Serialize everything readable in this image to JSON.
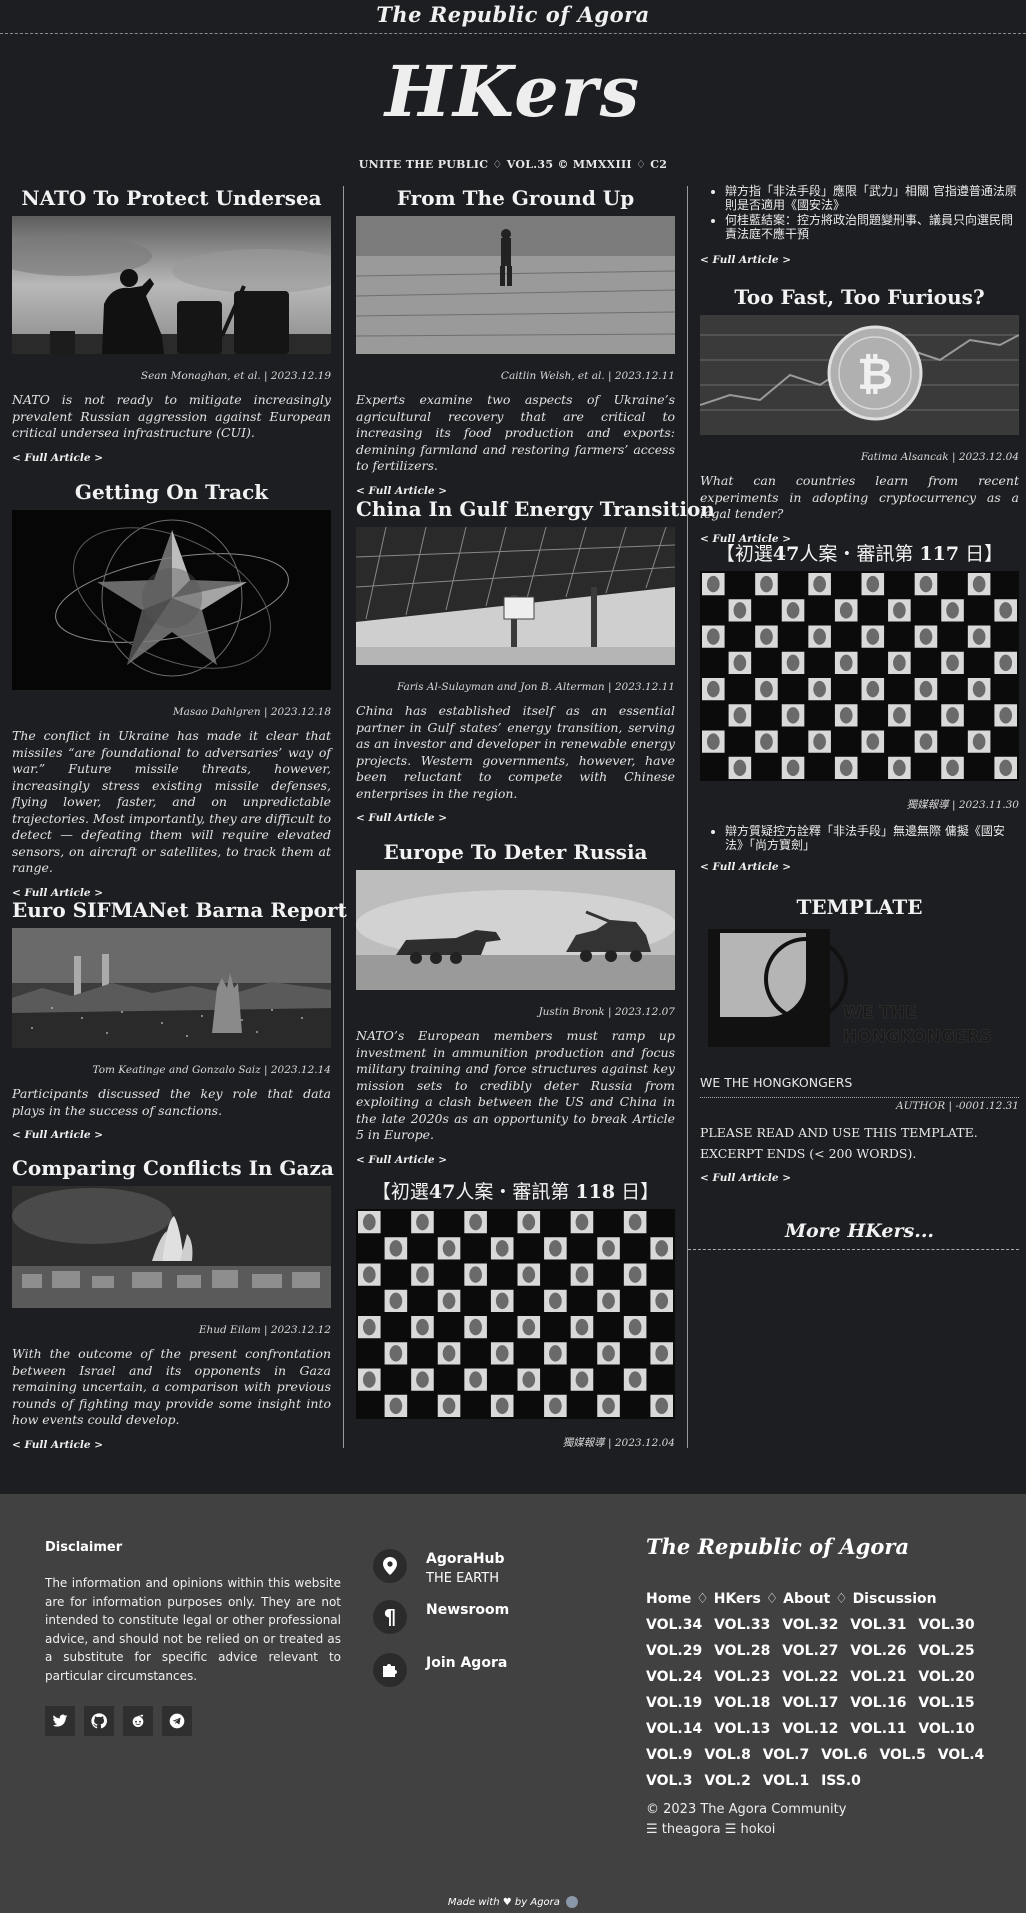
{
  "header": {
    "site_title": "The Republic of Agora",
    "logo": "HKers",
    "subline": "UNITE THE PUBLIC ♢ VOL.35 © MMXXIII ♢ C2"
  },
  "common": {
    "full_article": "< Full Article >"
  },
  "col1": [
    {
      "title": "NATO To Protect Undersea",
      "meta": "Sean Monaghan, et al. | 2023.12.19",
      "excerpt": "NATO is not ready to mitigate increasingly prevalent Russian aggression against European critical undersea infrastructure (CUI)."
    },
    {
      "title": "Getting On Track",
      "meta": "Masao Dahlgren | 2023.12.18",
      "excerpt": "The conflict in Ukraine has made it clear that missiles “are foundational to adversaries’ way of war.” Future missile threats, however, increasingly stress existing missile defenses, flying lower, faster, and on unpredictable trajectories. Most importantly, they are difficult to detect — defeating them will require elevated sensors, on aircraft or satellites, to track them at range."
    },
    {
      "title": "Euro SIFMANet Barna Report",
      "meta": "Tom Keatinge and Gonzalo Saiz | 2023.12.14",
      "excerpt": "Participants discussed the key role that data plays in the success of sanctions."
    },
    {
      "title": "Comparing Conflicts In Gaza",
      "meta": "Ehud Eilam | 2023.12.12",
      "excerpt": "With the outcome of the present confrontation between Israel and its opponents in Gaza remaining uncertain, a comparison with previous rounds of fighting may provide some insight into how events could develop."
    }
  ],
  "col2": [
    {
      "title": "From The Ground Up",
      "meta": "Caitlin Welsh, et al. | 2023.12.11",
      "excerpt": "Experts examine two aspects of Ukraine’s agricultural recovery that are critical to increasing its food production and exports: demining farmland and restoring farmers’ access to fertilizers."
    },
    {
      "title": "China In Gulf Energy Transition",
      "meta": "Faris Al-Sulayman and Jon B. Alterman | 2023.12.11",
      "excerpt": "China has established itself as an essential partner in Gulf states’ energy transition, serving as an investor and developer in renewable energy projects. Western governments, however, have been reluctant to compete with Chinese enterprises in the region."
    },
    {
      "title": "Europe To Deter Russia",
      "meta": "Justin Bronk | 2023.12.07",
      "excerpt": "NATO’s European members must ramp up investment in ammunition production and focus military training and force structures against key mission sets to credibly deter Russia from exploiting a clash between the US and China in the late 2020s as an opportunity to break Article 5 in Europe."
    },
    {
      "title_pre": "【初選",
      "title_b1": "47",
      "title_mid": "人案・審訊第 ",
      "title_b2": "118",
      "title_post": " 日】",
      "meta": "獨媒報導 | 2023.12.04"
    }
  ],
  "col3": {
    "top_bullets": [
      "辯方指「非法手段」應限「武力」相關 官指遵普通法原則是否適用《國安法》",
      "何桂藍結案：控方將政治問題變刑事、議員只向選民問責法庭不應干預"
    ],
    "bitcoin": {
      "title": "Too Fast, Too Furious?",
      "meta": "Fatima Alsancak | 2023.12.04",
      "excerpt": "What can countries learn from recent experiments in adopting cryptocurrency as a legal tender?"
    },
    "case117": {
      "title_pre": "【初選",
      "title_b1": "47",
      "title_mid": "人案・審訊第 ",
      "title_b2": "117",
      "title_post": " 日】",
      "meta": "獨媒報導 | 2023.11.30",
      "bullet": "辯方質疑控方詮釋「非法手段」無邊無際 傭擬《國安法》「尚方寶劍」"
    },
    "template": {
      "title": "TEMPLATE",
      "logo_text_1": "WE THE",
      "logo_text_2": "HONGKONGERS",
      "caption": "WE THE HONGKONGERS",
      "meta": "AUTHOR | -0001.12.31",
      "line1": "PLEASE READ AND USE THIS TEMPLATE.",
      "line2": "EXCERPT ENDS (< 200 WORDS)."
    },
    "more": "More HKers..."
  },
  "footer": {
    "disclaimer_title": "Disclaimer",
    "disclaimer_text": "The information and opinions within this website are for information purposes only. They are not intended to constitute legal or other professional advice, and should not be relied on or treated as a substitute for specific advice relevant to particular circumstances.",
    "social_icons": [
      "twitter-icon",
      "github-icon",
      "reddit-icon",
      "telegram-icon"
    ],
    "nav": [
      {
        "title": "AgoraHub",
        "sub": "THE EARTH",
        "icon": "location-pin-icon"
      },
      {
        "title": "Newsroom",
        "sub": "",
        "icon": "pilcrow-icon"
      },
      {
        "title": "Join Agora",
        "sub": "",
        "icon": "puzzle-icon"
      }
    ],
    "brand": "The Republic of Agora",
    "links": [
      "Home",
      "HKers",
      "About",
      "Discussion"
    ],
    "link_sep": "♢",
    "volumes": [
      "VOL.34",
      "VOL.33",
      "VOL.32",
      "VOL.31",
      "VOL.30",
      "VOL.29",
      "VOL.28",
      "VOL.27",
      "VOL.26",
      "VOL.25",
      "VOL.24",
      "VOL.23",
      "VOL.22",
      "VOL.21",
      "VOL.20",
      "VOL.19",
      "VOL.18",
      "VOL.17",
      "VOL.16",
      "VOL.15",
      "VOL.14",
      "VOL.13",
      "VOL.12",
      "VOL.11",
      "VOL.10",
      "VOL.9",
      "VOL.8",
      "VOL.7",
      "VOL.6",
      "VOL.5",
      "VOL.4",
      "VOL.3",
      "VOL.2",
      "VOL.1",
      "ISS.0"
    ],
    "copyright": "© 2023 The Agora Community",
    "handles": "☰ theagora ☰ hokoi",
    "made_with_pre": "Made with",
    "made_with_post": "by Agora"
  },
  "colors": {
    "background": "#1d1e22",
    "footer": "#414141",
    "text": "#e6e6e6"
  }
}
